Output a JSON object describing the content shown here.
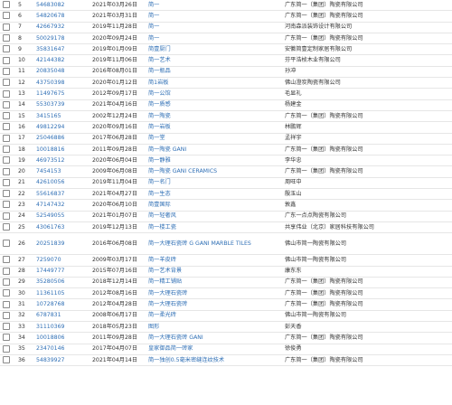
{
  "rows": [
    {
      "idx": "5",
      "reg": "54683082",
      "date": "2021年03月26日",
      "name": "简一",
      "owner": "广东简一（集团）陶瓷有限公司"
    },
    {
      "idx": "6",
      "reg": "54820678",
      "date": "2021年03月31日",
      "name": "简一",
      "owner": "广东简一（集团）陶瓷有限公司"
    },
    {
      "idx": "7",
      "reg": "42667932",
      "date": "2019年11月28日",
      "name": "简一",
      "owner": "河南森派装饰设计有限公司"
    },
    {
      "idx": "8",
      "reg": "50029178",
      "date": "2020年09月24日",
      "name": "简一",
      "owner": "广东简一（集团）陶瓷有限公司"
    },
    {
      "idx": "9",
      "reg": "35831647",
      "date": "2019年01月09日",
      "name": "简壹厨门",
      "owner": "安徽简壹定制家居有限公司"
    },
    {
      "idx": "10",
      "reg": "42144382",
      "date": "2019年11月06日",
      "name": "简一艺术",
      "owner": "芬平浩桢木业有限公司"
    },
    {
      "idx": "11",
      "reg": "20835048",
      "date": "2016年08月01日",
      "name": "简一瓶品",
      "owner": "孙冲"
    },
    {
      "idx": "12",
      "reg": "43750398",
      "date": "2020年01月12日",
      "name": "简1岩板",
      "owner": "佛山澄炭陶瓷有限公司"
    },
    {
      "idx": "13",
      "reg": "11497675",
      "date": "2012年09月17日",
      "name": "简一公馆",
      "owner": "毛显礼"
    },
    {
      "idx": "14",
      "reg": "55303739",
      "date": "2021年04月16日",
      "name": "简一质感",
      "owner": "杨建金"
    },
    {
      "idx": "15",
      "reg": "3415165",
      "date": "2002年12月24日",
      "name": "简一陶瓷",
      "owner": "广东简一（集团）陶瓷有限公司"
    },
    {
      "idx": "16",
      "reg": "49812294",
      "date": "2020年09月16日",
      "name": "简一岩板",
      "owner": "林鹏辉"
    },
    {
      "idx": "17",
      "reg": "25046886",
      "date": "2017年06月28日",
      "name": "简一堂",
      "owner": "孟祥宇"
    },
    {
      "idx": "18",
      "reg": "10018816",
      "date": "2011年09月28日",
      "name": "简一陶瓷 GANI",
      "owner": "广东简一（集团）陶瓷有限公司"
    },
    {
      "idx": "19",
      "reg": "46973512",
      "date": "2020年06月04日",
      "name": "简一静雅",
      "owner": "李华忠"
    },
    {
      "idx": "20",
      "reg": "7454153",
      "date": "2009年06月08日",
      "name": "简一陶瓷 GANI CERAMICS",
      "owner": "广东简一（集团）陶瓷有限公司"
    },
    {
      "idx": "21",
      "reg": "42610056",
      "date": "2019年11月04日",
      "name": "简一名门",
      "owner": "周旺中"
    },
    {
      "idx": "22",
      "reg": "55616837",
      "date": "2021年04月27日",
      "name": "简一生态",
      "owner": "殷玉山"
    },
    {
      "idx": "23",
      "reg": "47147432",
      "date": "2020年06月10日",
      "name": "简壹国际",
      "owner": "敦鑫"
    },
    {
      "idx": "24",
      "reg": "52549055",
      "date": "2021年01月07日",
      "name": "简一轻奢风",
      "owner": "广东一点点陶瓷有限公司"
    },
    {
      "idx": "25",
      "reg": "43061763",
      "date": "2019年12月13日",
      "name": "简一楼工瓷",
      "owner": "共享伟业（北京）家居科技有限公司"
    },
    {
      "idx": "26",
      "reg": "20251839",
      "date": "2016年06月08日",
      "name": "简一大理石瓷砖 G GANI MARBLE TILES",
      "owner": "佛山市简一陶瓷有限公司",
      "tall": true
    },
    {
      "idx": "27",
      "reg": "7259070",
      "date": "2009年03月17日",
      "name": "简一羊皮砖",
      "owner": "佛山市简一陶瓷有限公司"
    },
    {
      "idx": "28",
      "reg": "17449777",
      "date": "2015年07月16日",
      "name": "简一艺术背景",
      "owner": "康东东"
    },
    {
      "idx": "29",
      "reg": "35280506",
      "date": "2018年12月14日",
      "name": "简一精工铺贴",
      "owner": "广东简一（集团）陶瓷有限公司"
    },
    {
      "idx": "30",
      "reg": "11361105",
      "date": "2012年08月16日",
      "name": "简一大理石瓷砖",
      "owner": "广东简一（集团）陶瓷有限公司"
    },
    {
      "idx": "31",
      "reg": "10728768",
      "date": "2012年04月28日",
      "name": "简一大理石瓷砖",
      "owner": "广东简一（集团）陶瓷有限公司"
    },
    {
      "idx": "32",
      "reg": "6787831",
      "date": "2008年06月17日",
      "name": "简一柔光砖",
      "owner": "佛山市简一陶瓷有限公司"
    },
    {
      "idx": "33",
      "reg": "31110369",
      "date": "2018年05月23日",
      "name": "图形",
      "owner": "彭天香"
    },
    {
      "idx": "34",
      "reg": "10018806",
      "date": "2011年09月28日",
      "name": "简一大理石瓷砖 GANI",
      "owner": "广东简一（集团）陶瓷有限公司"
    },
    {
      "idx": "35",
      "reg": "23470146",
      "date": "2017年04月07日",
      "name": "皇家御品简一砖家",
      "owner": "徐俊勇"
    },
    {
      "idx": "36",
      "reg": "54839927",
      "date": "2021年04月14日",
      "name": "简一独创0.5毫米密缝连纹技术",
      "owner": "广东简一（集团）陶瓷有限公司"
    }
  ]
}
